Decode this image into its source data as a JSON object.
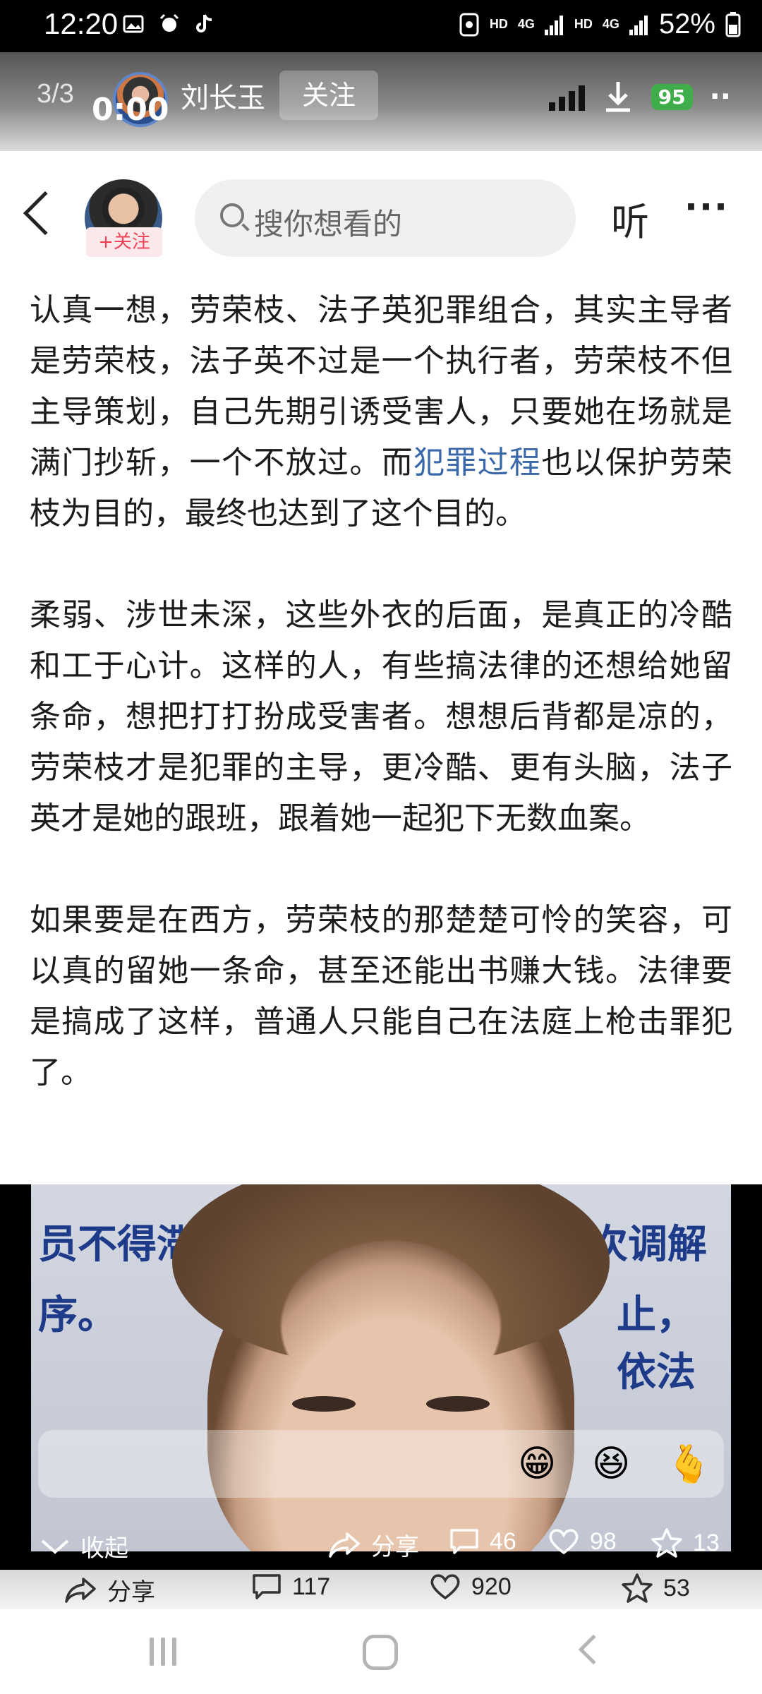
{
  "status_bar": {
    "time": "12:20",
    "hd1": "HD",
    "net1": "4G",
    "hd2": "HD",
    "net2": "4G",
    "battery": "52%"
  },
  "video_header": {
    "index": "3/3",
    "author": "刘长玉",
    "follow": "关注",
    "counter": "0:00",
    "battery_pill": "95"
  },
  "header": {
    "follow_badge": "+关注",
    "search_placeholder": "搜你想看的",
    "listen": "听",
    "more": "···"
  },
  "article": {
    "p1_a": "认真一想，劳荣枝、法子英犯罪组合，其实主导者是劳荣枝，法子英不过是一个执行者，劳荣枝不但主导策划，自己先期引诱受害人，只要她在场就是满门抄斩，一个不放过。而",
    "p1_link": "犯罪过程",
    "p1_b": "也以保护劳荣枝为目的，最终也达到了这个目的。",
    "p2": "柔弱、涉世未深，这些外衣的后面，是真正的冷酷和工于心计。这样的人，有些搞法律的还想给她留条命，想把打打扮成受害者。想想后背都是凉的，劳荣枝才是犯罪的主导，更冷酷、更有头脑，法子英才是她的跟班，跟着她一起犯下无数血案。",
    "p3": "如果要是在西方，劳荣枝的那楚楚可怜的笑容，可以真的留她一条命，甚至还能出书赚大钱。法律要是搞成了这样，普通人只能自己在法庭上枪击罪犯了。"
  },
  "media": {
    "wall_left_1": "员不得滞",
    "wall_left_2": "序。",
    "wall_right_1": "次调解",
    "wall_right_2": "止，依法",
    "emojis": [
      "😁",
      "😆",
      "🫰"
    ]
  },
  "overlay_actions": {
    "collapse": "收起",
    "share": "分享",
    "comments": "46",
    "likes": "98",
    "favorites": "13"
  },
  "bottom_actions": {
    "share": "分享",
    "comments": "117",
    "likes": "920",
    "favorites": "53"
  }
}
